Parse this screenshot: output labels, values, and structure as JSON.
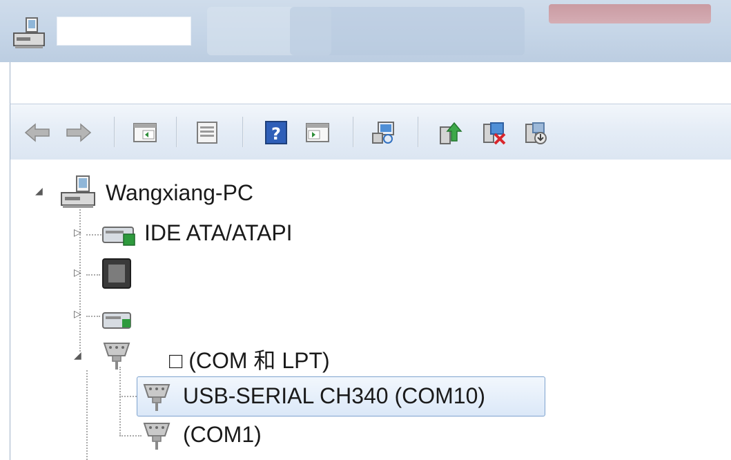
{
  "window": {
    "title": "",
    "app_icon": "computer-icon"
  },
  "toolbar": {
    "buttons": [
      {
        "name": "back-icon"
      },
      {
        "name": "forward-icon"
      },
      {
        "name": "show-hide-console-tree-icon"
      },
      {
        "name": "properties-icon"
      },
      {
        "name": "help-icon"
      },
      {
        "name": "show-action-pane-icon"
      },
      {
        "name": "scan-hardware-changes-icon"
      },
      {
        "name": "update-driver-icon"
      },
      {
        "name": "uninstall-device-icon"
      },
      {
        "name": "disable-device-icon"
      }
    ]
  },
  "tree": {
    "root": {
      "label": "Wangxiang-PC",
      "icon": "computer-icon",
      "expanded": true
    },
    "categories": [
      {
        "label": "IDE ATA/ATAPI",
        "icon": "ide-controller-icon",
        "expanded": false
      },
      {
        "label": "",
        "icon": "processor-icon",
        "expanded": false
      },
      {
        "label": "",
        "icon": "storage-controller-icon",
        "expanded": false
      },
      {
        "label": "□ (COM 和 LPT)",
        "icon": "port-icon",
        "expanded": true,
        "children": [
          {
            "label": "USB-SERIAL CH340 (COM10)",
            "icon": "port-icon",
            "selected": true
          },
          {
            "label": "(COM1)",
            "icon": "port-icon",
            "selected": false
          }
        ]
      }
    ]
  },
  "colors": {
    "titlebar": "#c5d5e7",
    "toolbar": "#e4ecf6",
    "selection_border": "#7da2ce",
    "selection_fill": "#dbe8f8"
  }
}
